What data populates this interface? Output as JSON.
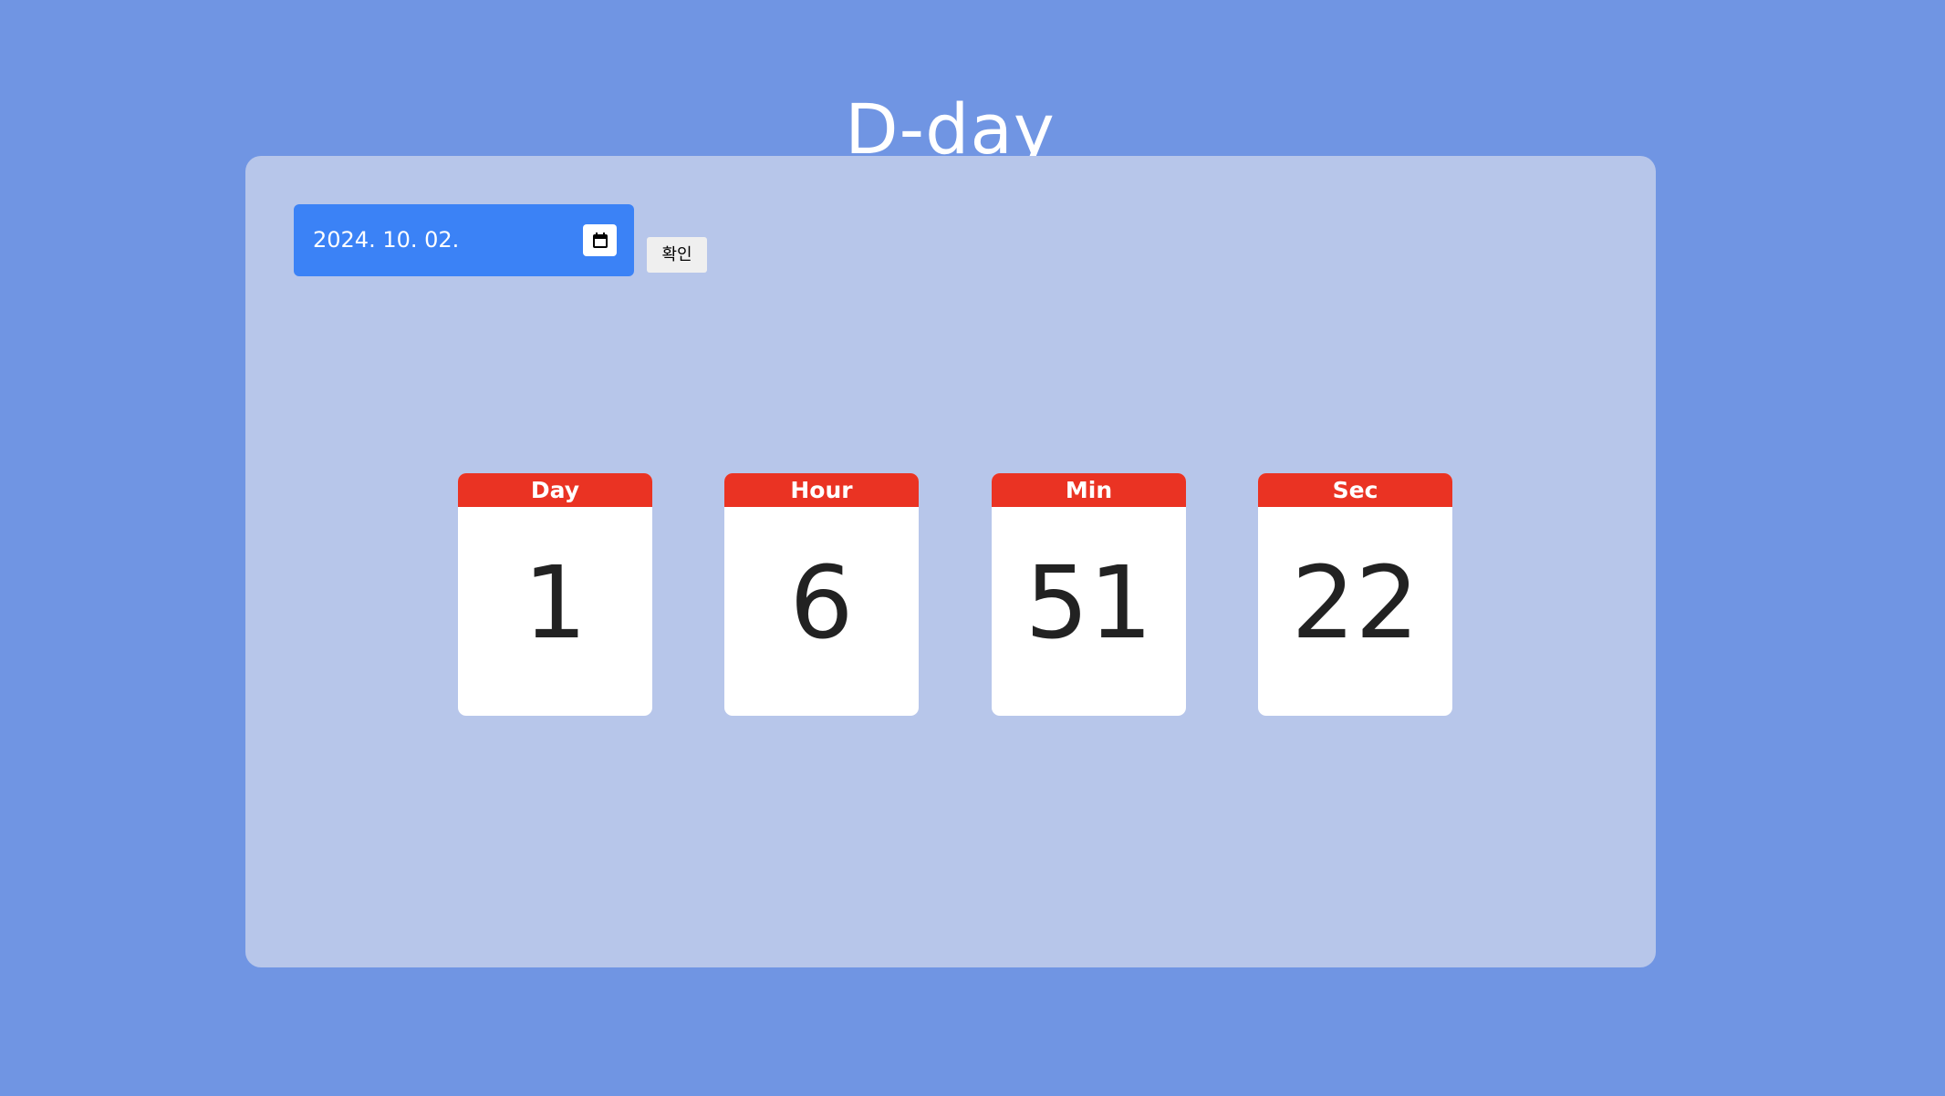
{
  "page": {
    "title": "D-day"
  },
  "form": {
    "date_value": "2024. 10. 02.",
    "calendar_icon": "calendar-icon",
    "confirm_label": "확인"
  },
  "countdown": [
    {
      "label": "Day",
      "value": "1"
    },
    {
      "label": "Hour",
      "value": "6"
    },
    {
      "label": "Min",
      "value": "51"
    },
    {
      "label": "Sec",
      "value": "22"
    }
  ],
  "colors": {
    "background": "#7095e3",
    "panel": "#b7c6ea",
    "date_input": "#3b82f6",
    "card_header": "#ea3323",
    "card_body": "#ffffff",
    "number_text": "#222222"
  }
}
